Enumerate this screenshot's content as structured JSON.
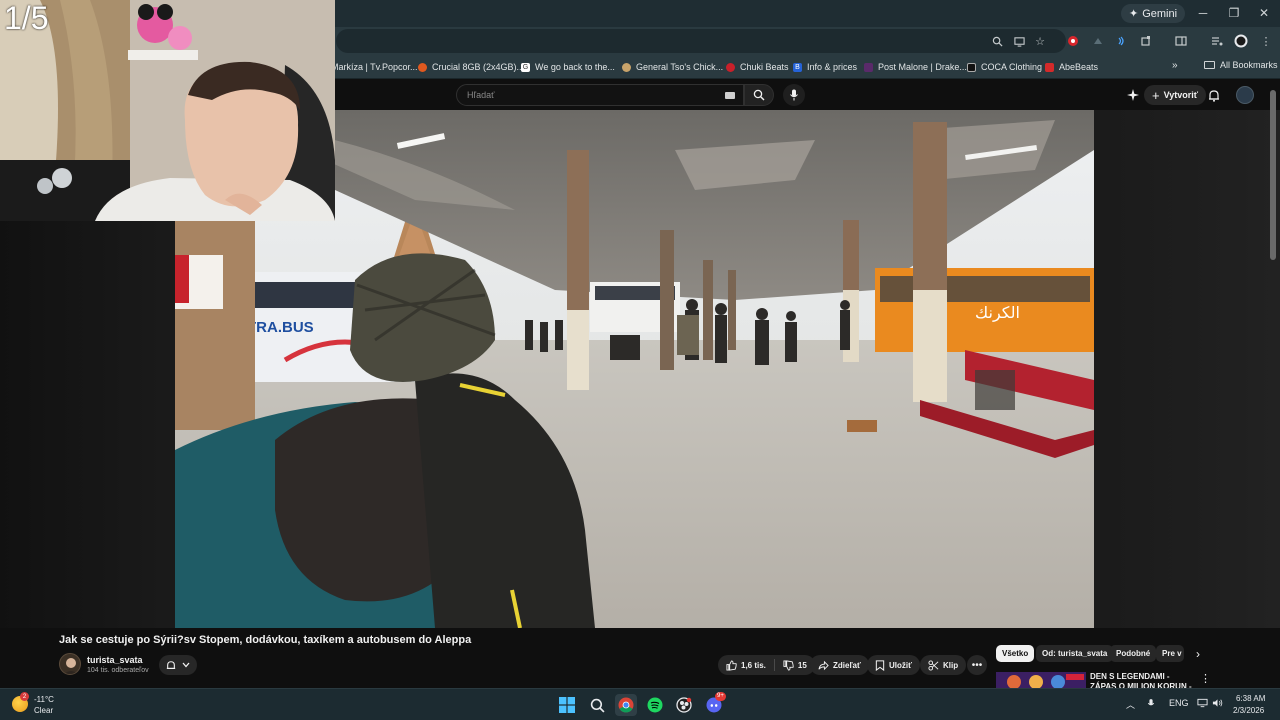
{
  "browser": {
    "gemini_label": "Gemini",
    "bookmarks": [
      {
        "label": "Markíza | Tv.Popcor...",
        "color": "#2a3a40"
      },
      {
        "label": "Crucial 8GB (2x4GB)...",
        "color": "#e0591f"
      },
      {
        "label": "We go back to the...",
        "color": "#ffffff"
      },
      {
        "label": "General Tso's Chick...",
        "color": "#c8a36a"
      },
      {
        "label": "Chuki Beats",
        "color": "#c8202a"
      },
      {
        "label": "Info & prices",
        "color": "#2563d8"
      },
      {
        "label": "Post Malone | Drake...",
        "color": "#5a2a6a"
      },
      {
        "label": "COCA Clothing",
        "color": "#111111"
      },
      {
        "label": "AbeBeats",
        "color": "#d42a2a"
      }
    ],
    "all_bookmarks_label": "All Bookmarks"
  },
  "youtube": {
    "search_placeholder": "Hľadať",
    "create_label": "Vytvoriť",
    "video_title": "Jak se cestuje po Sýrii?sv Stopem, dodávkou, taxíkem a autobusem do Aleppa",
    "channel_name": "turista_svata",
    "subscribers": "104 tis. odberateľov",
    "likes": "1,6 tis.",
    "dislikes": "15",
    "share_label": "Zdieľať",
    "save_label": "Uložiť",
    "clip_label": "Klip",
    "chips": [
      "Všetko",
      "Od: turista_svata",
      "Podobné",
      "Pre v"
    ],
    "recommended_title": "DEN S LEGENDAMI - ZÁPAS O MILION KORUN - Cypro"
  },
  "overlay": {
    "page_counter": "1/5"
  },
  "video_scene": {
    "bus_left_text": "TRA.BUS",
    "bus_right_text": "الكرنك"
  },
  "taskbar": {
    "temperature": "-11°C",
    "condition": "Clear",
    "weather_badge": "2",
    "discord_badge": "9+",
    "language": "ENG",
    "time": "6:38 AM",
    "date": "2/3/2026"
  }
}
